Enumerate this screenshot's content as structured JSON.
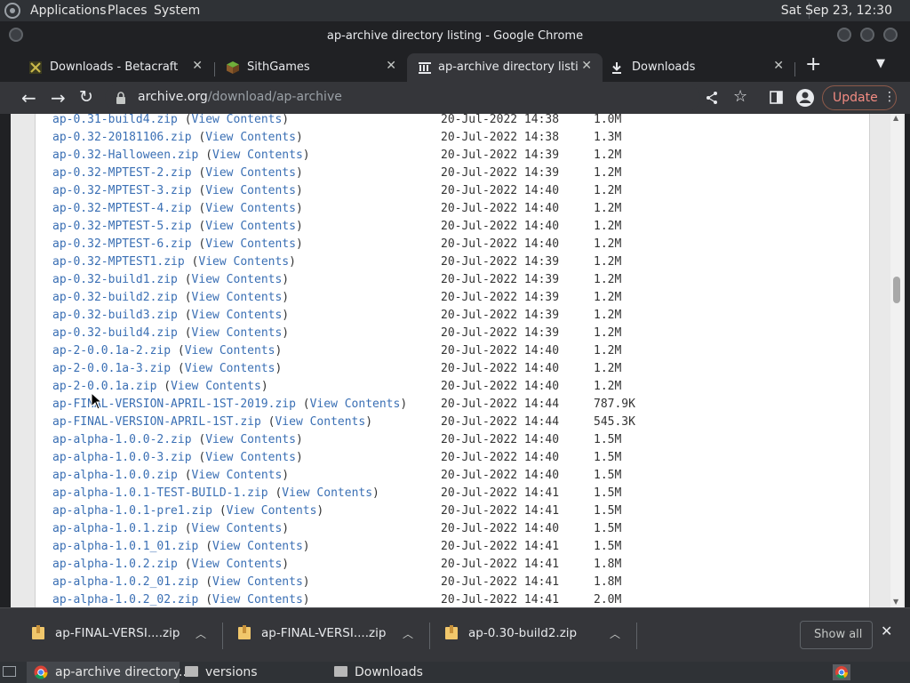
{
  "panel": {
    "menus": [
      "Applications",
      "Places",
      "System"
    ],
    "clock": "Sat Sep 23, 12:30"
  },
  "window": {
    "title": "ap-archive directory listing - Google Chrome"
  },
  "tabs": [
    {
      "label": "Downloads - Betacraft",
      "icon": "betacraft-icon"
    },
    {
      "label": "SithGames",
      "icon": "grass-block-icon"
    },
    {
      "label": "ap-archive directory listing",
      "icon": "archive-org-icon",
      "active": true
    },
    {
      "label": "Downloads",
      "icon": "download-icon"
    }
  ],
  "toolbar": {
    "url_host": "archive.org",
    "url_path": "/download/ap-archive",
    "update_label": "Update"
  },
  "listing": {
    "view_label": "View Contents",
    "rows": [
      {
        "name": "ap-0.31-build4.zip",
        "date": "20-Jul-2022 14:38",
        "size": "1.0M"
      },
      {
        "name": "ap-0.32-20181106.zip",
        "date": "20-Jul-2022 14:38",
        "size": "1.3M"
      },
      {
        "name": "ap-0.32-Halloween.zip",
        "date": "20-Jul-2022 14:39",
        "size": "1.2M"
      },
      {
        "name": "ap-0.32-MPTEST-2.zip",
        "date": "20-Jul-2022 14:39",
        "size": "1.2M"
      },
      {
        "name": "ap-0.32-MPTEST-3.zip",
        "date": "20-Jul-2022 14:40",
        "size": "1.2M"
      },
      {
        "name": "ap-0.32-MPTEST-4.zip",
        "date": "20-Jul-2022 14:40",
        "size": "1.2M"
      },
      {
        "name": "ap-0.32-MPTEST-5.zip",
        "date": "20-Jul-2022 14:40",
        "size": "1.2M"
      },
      {
        "name": "ap-0.32-MPTEST-6.zip",
        "date": "20-Jul-2022 14:40",
        "size": "1.2M"
      },
      {
        "name": "ap-0.32-MPTEST1.zip",
        "date": "20-Jul-2022 14:39",
        "size": "1.2M"
      },
      {
        "name": "ap-0.32-build1.zip",
        "date": "20-Jul-2022 14:39",
        "size": "1.2M"
      },
      {
        "name": "ap-0.32-build2.zip",
        "date": "20-Jul-2022 14:39",
        "size": "1.2M"
      },
      {
        "name": "ap-0.32-build3.zip",
        "date": "20-Jul-2022 14:39",
        "size": "1.2M"
      },
      {
        "name": "ap-0.32-build4.zip",
        "date": "20-Jul-2022 14:39",
        "size": "1.2M"
      },
      {
        "name": "ap-2-0.0.1a-2.zip",
        "date": "20-Jul-2022 14:40",
        "size": "1.2M"
      },
      {
        "name": "ap-2-0.0.1a-3.zip",
        "date": "20-Jul-2022 14:40",
        "size": "1.2M"
      },
      {
        "name": "ap-2-0.0.1a.zip",
        "date": "20-Jul-2022 14:40",
        "size": "1.2M"
      },
      {
        "name": "ap-FINAL-VERSION-APRIL-1ST-2019.zip",
        "date": "20-Jul-2022 14:44",
        "size": "787.9K"
      },
      {
        "name": "ap-FINAL-VERSION-APRIL-1ST.zip",
        "date": "20-Jul-2022 14:44",
        "size": "545.3K"
      },
      {
        "name": "ap-alpha-1.0.0-2.zip",
        "date": "20-Jul-2022 14:40",
        "size": "1.5M"
      },
      {
        "name": "ap-alpha-1.0.0-3.zip",
        "date": "20-Jul-2022 14:40",
        "size": "1.5M"
      },
      {
        "name": "ap-alpha-1.0.0.zip",
        "date": "20-Jul-2022 14:40",
        "size": "1.5M"
      },
      {
        "name": "ap-alpha-1.0.1-TEST-BUILD-1.zip",
        "date": "20-Jul-2022 14:41",
        "size": "1.5M"
      },
      {
        "name": "ap-alpha-1.0.1-pre1.zip",
        "date": "20-Jul-2022 14:41",
        "size": "1.5M"
      },
      {
        "name": "ap-alpha-1.0.1.zip",
        "date": "20-Jul-2022 14:40",
        "size": "1.5M"
      },
      {
        "name": "ap-alpha-1.0.1_01.zip",
        "date": "20-Jul-2022 14:41",
        "size": "1.5M"
      },
      {
        "name": "ap-alpha-1.0.2.zip",
        "date": "20-Jul-2022 14:41",
        "size": "1.8M"
      },
      {
        "name": "ap-alpha-1.0.2_01.zip",
        "date": "20-Jul-2022 14:41",
        "size": "1.8M"
      },
      {
        "name": "ap-alpha-1.0.2_02.zip",
        "date": "20-Jul-2022 14:41",
        "size": "2.0M"
      }
    ]
  },
  "downloads": {
    "items": [
      "ap-FINAL-VERSI....zip",
      "ap-FINAL-VERSI....zip",
      "ap-0.30-build2.zip"
    ],
    "show_all": "Show all"
  },
  "taskbar": {
    "items": [
      {
        "label": "ap-archive directory...",
        "icon": "chrome-icon",
        "active": true
      },
      {
        "label": "versions",
        "icon": "folder-icon"
      },
      {
        "label": "Downloads",
        "icon": "folder-icon"
      }
    ]
  },
  "colors": {
    "link": "#3a6fb4",
    "chrome_dark": "#202124",
    "toolbar": "#35363a",
    "update_accent": "#f28b82"
  }
}
